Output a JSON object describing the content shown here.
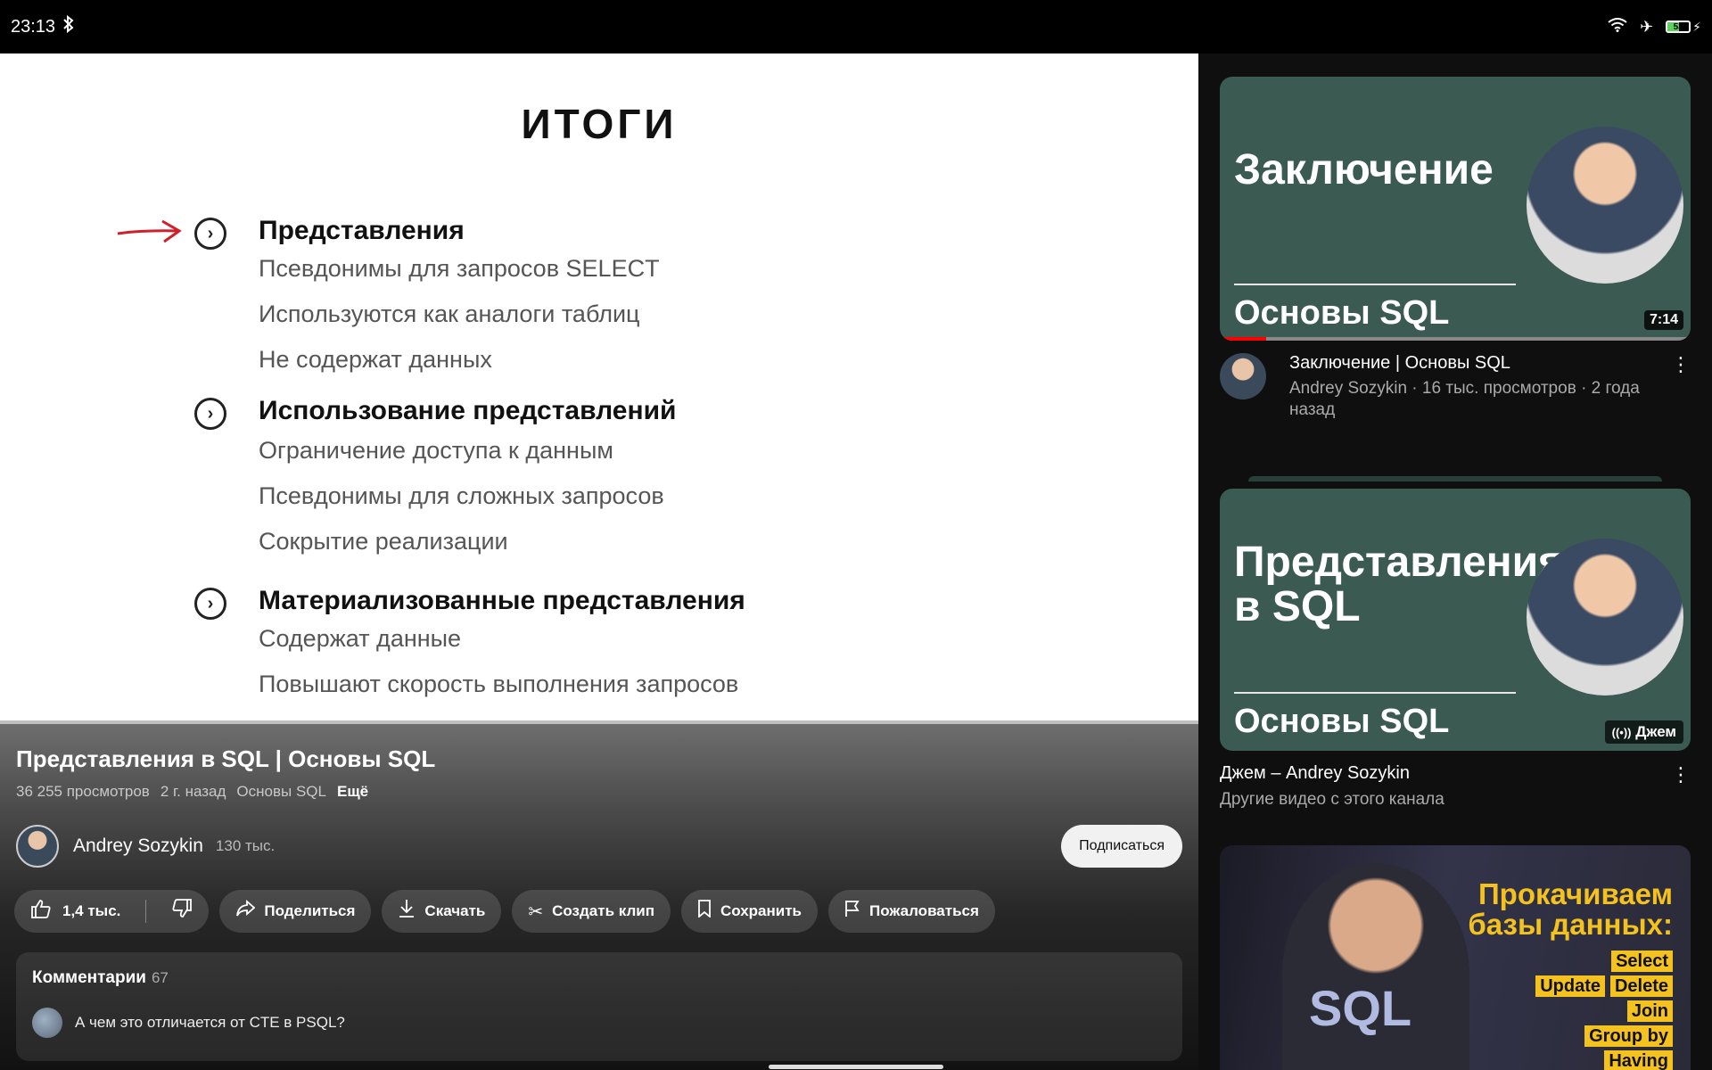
{
  "status": {
    "time": "23:13",
    "battery": "53"
  },
  "slide": {
    "title": "ИТОГИ",
    "sections": [
      {
        "heading": "Представления",
        "items": [
          "Псевдонимы для запросов SELECT",
          "Используются как аналоги таблиц",
          "Не содержат данных"
        ]
      },
      {
        "heading": "Использование представлений",
        "items": [
          "Ограничение доступа к данным",
          "Псевдонимы для сложных запросов",
          "Сокрытие реализации"
        ]
      },
      {
        "heading": "Материализованные представления",
        "items": [
          "Содержат данные",
          "Повышают скорость выполнения запросов"
        ]
      }
    ]
  },
  "video": {
    "title": "Представления в SQL | Основы SQL",
    "views": "36 255 просмотров",
    "age": "2 г. назад",
    "playlist": "Основы SQL",
    "more": "Ещё",
    "channel": "Andrey Sozykin",
    "subscribers": "130 тыс.",
    "subscribe": "Подписаться"
  },
  "actions": {
    "likes": "1,4 тыс.",
    "share": "Поделиться",
    "download": "Скачать",
    "clip": "Создать клип",
    "save": "Сохранить",
    "report": "Пожаловаться"
  },
  "comments": {
    "label": "Комментарии",
    "count": "67",
    "first": "А чем это отличается от CTE в PSQL?"
  },
  "related": [
    {
      "thumb_title": "Заключение",
      "thumb_footer": "Основы SQL",
      "duration": "7:14",
      "title": "Заключение | Основы SQL",
      "sub": "Andrey Sozykin · 16 тыс. просмотров · 2 года назад"
    },
    {
      "thumb_title_1": "Представления",
      "thumb_title_2": "в SQL",
      "thumb_footer": "Основы SQL",
      "badge": "Джем",
      "title": "Джем – Andrey Sozykin",
      "sub": "Другие видео с этого канала"
    },
    {
      "line1": "Прокачиваем",
      "line2": "базы данных:",
      "sql": "SQL",
      "tags": [
        "Select",
        "Update",
        "Delete",
        "Join",
        "Group by",
        "Having"
      ]
    }
  ]
}
